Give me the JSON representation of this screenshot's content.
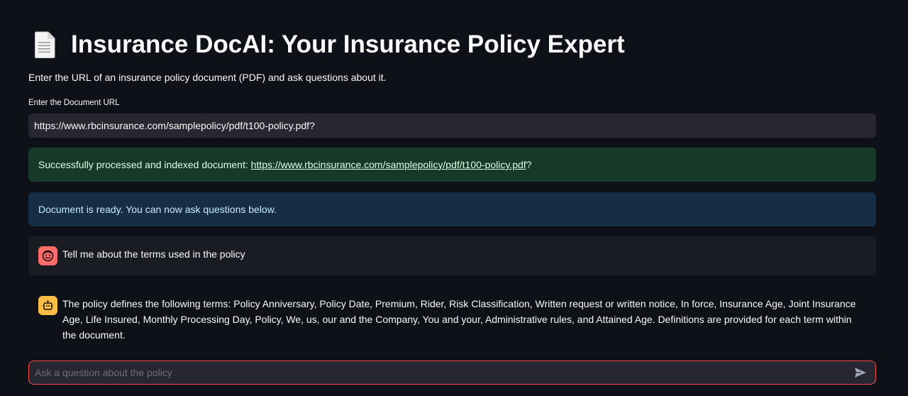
{
  "header": {
    "title": "Insurance DocAI: Your Insurance Policy Expert",
    "icon": "page-facing-up-icon"
  },
  "intro": {
    "subtitle": "Enter the URL of an insurance policy document (PDF) and ask questions about it."
  },
  "url_field": {
    "label": "Enter the Document URL",
    "value": "https://www.rbcinsurance.com/samplepolicy/pdf/t100-policy.pdf?"
  },
  "alerts": {
    "success_prefix": "Successfully processed and indexed document: ",
    "success_link": "https://www.rbcinsurance.com/samplepolicy/pdf/t100-policy.pdf",
    "success_suffix": "?",
    "info": "Document is ready. You can now ask questions below."
  },
  "chat": {
    "messages": [
      {
        "role": "user",
        "avatar_icon": "user-face-icon",
        "text": "Tell me about the terms used in the policy"
      },
      {
        "role": "assistant",
        "avatar_icon": "robot-icon",
        "text": "The policy defines the following terms: Policy Anniversary, Policy Date, Premium, Rider, Risk Classification, Written request or written notice, In force, Insurance Age, Joint Insurance Age, Life Insured, Monthly Processing Day, Policy, We, us, our and the Company, You and your, Administrative rules, and Attained Age. Definitions are provided for each term within the document."
      }
    ],
    "input_placeholder": "Ask a question about the policy",
    "send_icon": "send-icon"
  },
  "colors": {
    "background": "#0e1117",
    "input_bg": "#262730",
    "success_bg": "#173928",
    "info_bg": "#172d43",
    "user_avatar": "#ff6a6a",
    "assistant_avatar": "#ffbd45",
    "accent_border": "#ff4b4b"
  }
}
